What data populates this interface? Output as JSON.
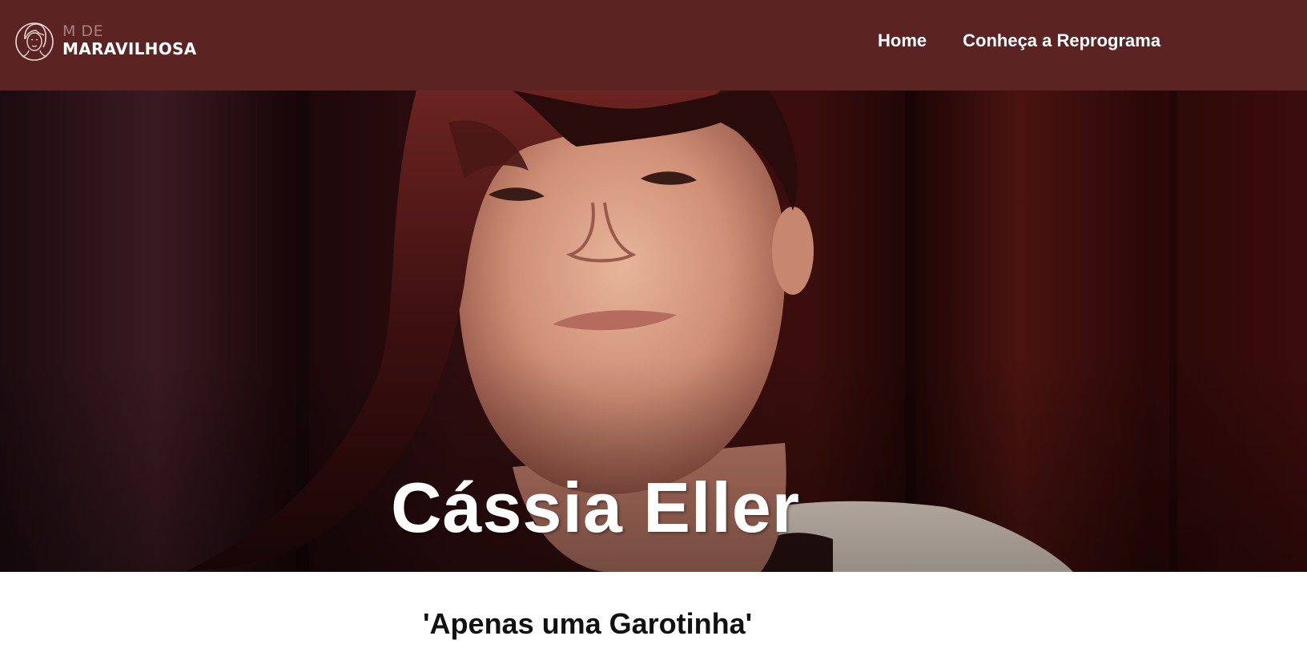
{
  "header": {
    "logo": {
      "line1": "M DE",
      "line2": "MARAVILHOSA",
      "icon": "woman-face-icon"
    },
    "nav": [
      {
        "label": "Home"
      },
      {
        "label": "Conheça a Reprograma"
      }
    ]
  },
  "hero": {
    "title": "Cássia Eller",
    "image": "portrait-photo"
  },
  "content": {
    "subtitle": "'Apenas uma Garotinha'"
  },
  "colors": {
    "header_bg": "#5c2323",
    "hero_bg": "#2a0a0b",
    "text_dark": "#111111"
  }
}
